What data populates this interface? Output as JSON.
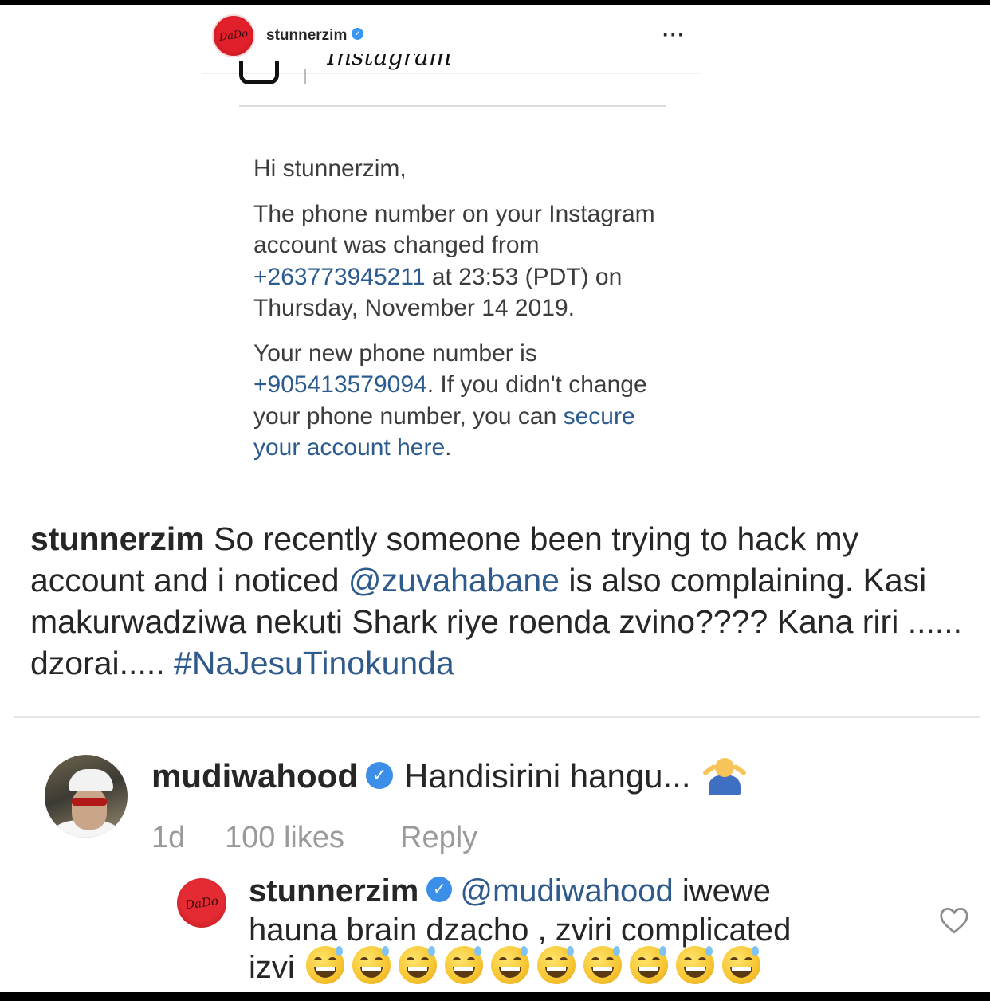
{
  "post_header": {
    "username": "stunnerzim",
    "avatar_text": "DaDo",
    "verified": true,
    "more_icon": "more-horizontal-icon"
  },
  "email": {
    "greeting": "Hi stunnerzim,",
    "p1_before": "The phone number on your Instagram account was changed from ",
    "old_phone": "+263773945211",
    "p1_after": " at 23:53 (PDT) on Thursday, November 14 2019.",
    "p2_before": "Your new phone number is ",
    "new_phone": "+905413579094",
    "p2_middle": ". If you didn't change your phone number, you can ",
    "secure_link": "secure your account here",
    "p2_after": "."
  },
  "caption": {
    "username": "stunnerzim",
    "text1": " So recently someone been trying to hack my account and i noticed ",
    "mention": "@zuvahabane",
    "text2": " is also complaining. Kasi makurwadziwa nekuti Shark riye roenda zvino???? Kana riri ...... dzorai..... ",
    "hashtag": "#NaJesuTinokunda"
  },
  "comment": {
    "username": "mudiwahood",
    "verified": true,
    "text": "Handisirini hangu...",
    "emoji": "person-shrugging",
    "time": "1d",
    "likes": "100 likes",
    "reply_label": "Reply"
  },
  "reply": {
    "username": "stunnerzim",
    "avatar_text": "DaDo",
    "verified": true,
    "mention": "@mudiwahood",
    "text_line1": " iwewe",
    "text_line2": "hauna brain dzacho , zviri complicated",
    "text_line3": "izvi",
    "emoji": "grinning-face-with-sweat",
    "emoji_count": 10,
    "like_icon": "heart-outline-icon"
  },
  "colors": {
    "link_blue": "#2f5a8c",
    "verified_blue": "#3b8fe8",
    "muted_gray": "#9a9a9a",
    "avatar_red": "#e42b33"
  }
}
